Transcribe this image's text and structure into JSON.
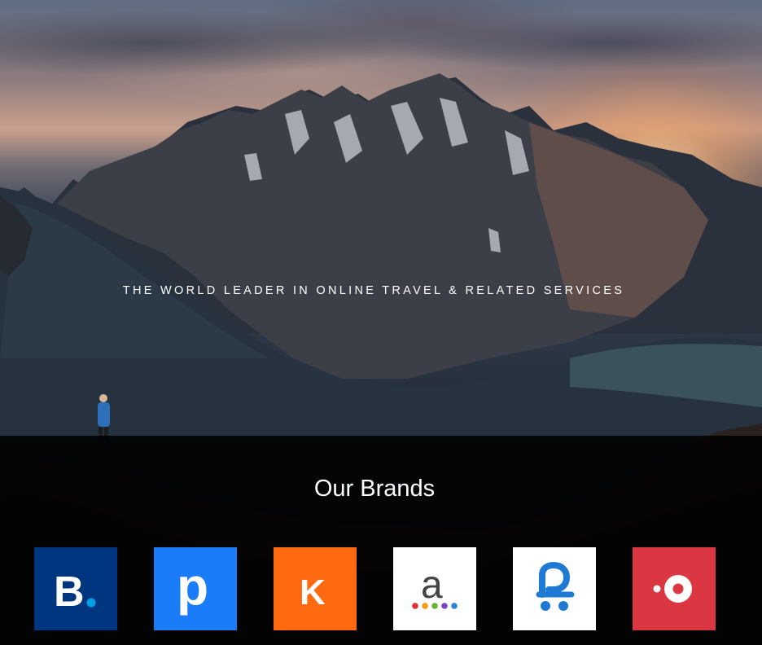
{
  "hero": {
    "tagline": "THE WORLD LEADER IN ONLINE TRAVEL & RELATED SERVICES"
  },
  "brands": {
    "title": "Our Brands",
    "items": [
      {
        "name": "booking-logo",
        "glyph": "B.",
        "color": "#003580"
      },
      {
        "name": "priceline-logo",
        "glyph": "p",
        "color": "#1a7cf8"
      },
      {
        "name": "kayak-logo",
        "glyph": "K",
        "color": "#ff690f"
      },
      {
        "name": "agoda-logo",
        "glyph": "a",
        "color": "#ffffff"
      },
      {
        "name": "rentalcars-logo",
        "glyph": "",
        "color": "#ffffff"
      },
      {
        "name": "opentable-logo",
        "glyph": "",
        "color": "#da3743"
      }
    ]
  }
}
